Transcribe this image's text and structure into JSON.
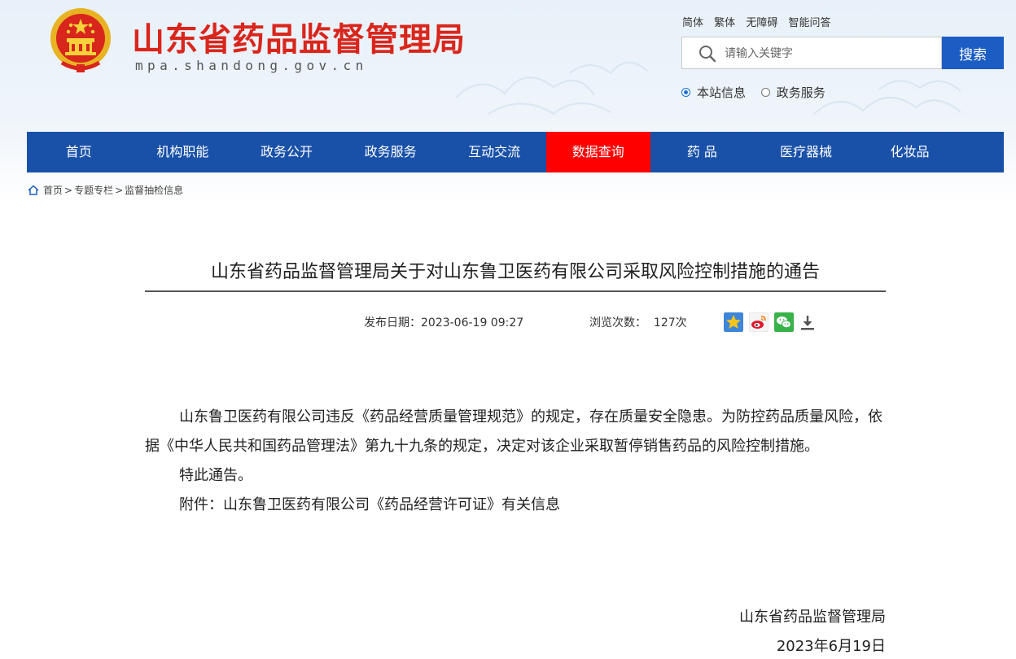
{
  "header": {
    "site_name": "山东省药品监督管理局",
    "site_domain": "mpa.shandong.gov.cn",
    "links": [
      "简体",
      "繁体",
      "无障碍",
      "智能问答"
    ],
    "search": {
      "placeholder": "请输入关键字",
      "button": "搜索"
    },
    "scope_options": [
      {
        "label": "本站信息",
        "selected": true
      },
      {
        "label": "政务服务",
        "selected": false
      }
    ]
  },
  "nav": {
    "items": [
      "首页",
      "机构职能",
      "政务公开",
      "政务服务",
      "互动交流",
      "数据查询",
      "药 品",
      "医疗器械",
      "化妆品"
    ],
    "active": "数据查询"
  },
  "breadcrumb": [
    "首页",
    "专题专栏",
    "监督抽检信息"
  ],
  "article": {
    "title": "山东省药品监督管理局关于对山东鲁卫医药有限公司采取风险控制措施的通告",
    "publish_label": "发布日期：",
    "publish_date": "2023-06-19 09:27",
    "views_label": "浏览次数：",
    "views": "127次",
    "paragraphs": [
      "山东鲁卫医药有限公司违反《药品经营质量管理规范》的规定，存在质量安全隐患。为防控药品质量风险，依据《中华人民共和国药品管理法》第九十九条的规定，决定对该企业采取暂停销售药品的风险控制措施。",
      "特此通告。",
      "附件：山东鲁卫医药有限公司《药品经营许可证》有关信息"
    ],
    "signature": "山东省药品监督管理局",
    "sign_date": "2023年6月19日"
  },
  "share_icons": [
    "favorite-star-icon",
    "weibo-icon",
    "wechat-icon",
    "download-icon"
  ],
  "colors": {
    "nav_bg": "#1951a8",
    "nav_active": "#ff0000",
    "title_red": "#d9261c",
    "search_btn": "#1b5dc3"
  }
}
